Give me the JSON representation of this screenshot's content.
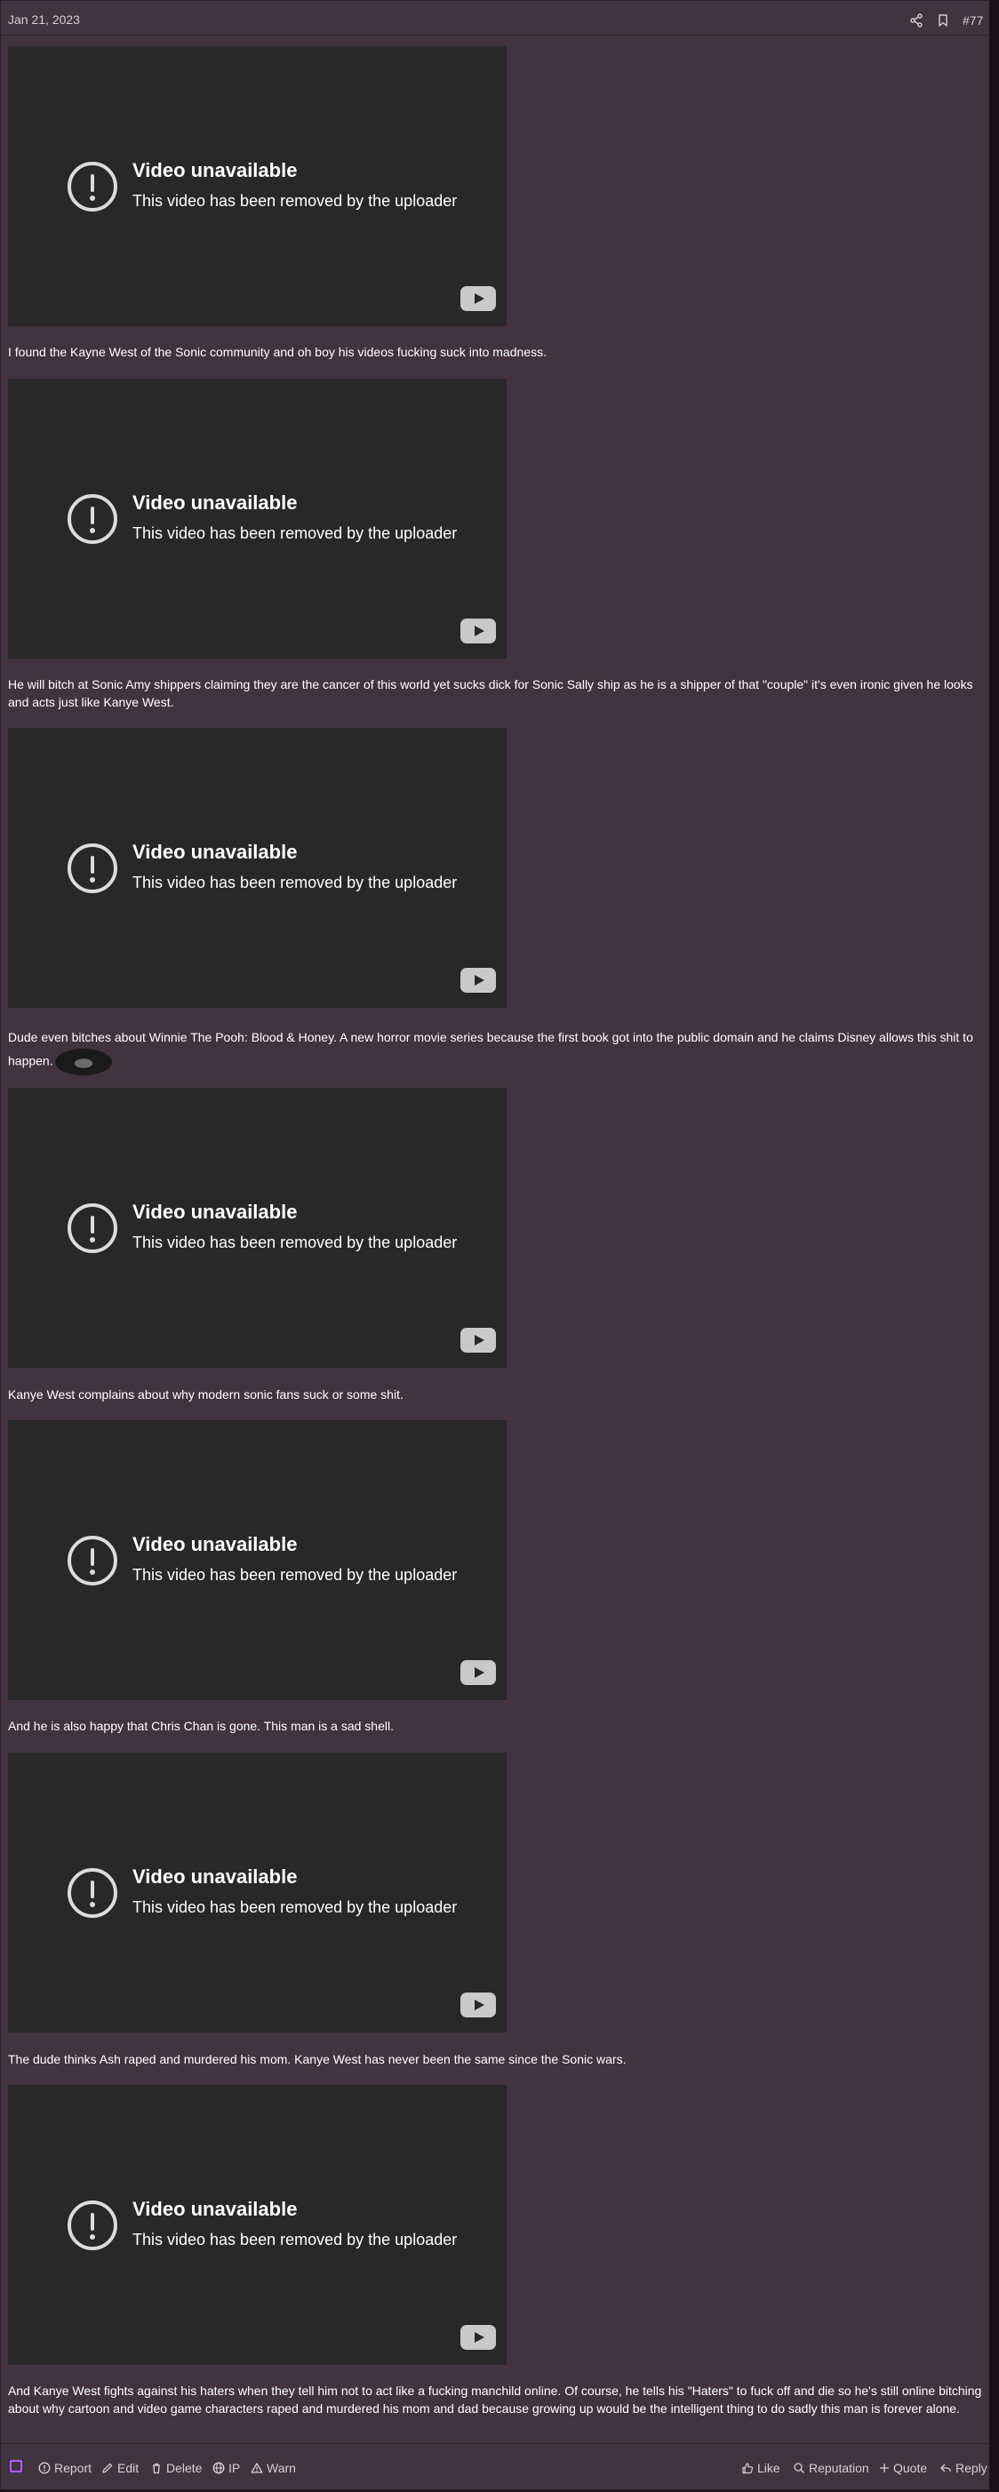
{
  "header": {
    "date": "Jan 21, 2023",
    "post_number": "#77",
    "share_icon": "share-icon",
    "bookmark_icon": "bookmark-icon"
  },
  "video": {
    "title": "Video unavailable",
    "subtitle": "This video has been removed by the uploader",
    "warning_icon": "exclamation-circle-icon",
    "play_icon": "youtube-play-icon"
  },
  "paragraphs": [
    "I found the Kayne West of the Sonic community and oh boy his videos fucking suck into madness.",
    "He will bitch at Sonic Amy shippers claiming they are the cancer of this world yet sucks dick for Sonic Sally ship as he is a shipper of that \"couple\" it's even ironic given he looks and acts just like Kanye West.",
    "Dude even bitches about Winnie The Pooh: Blood & Honey. A new horror movie series because the first book got into the public domain and he claims Disney allows this shit to happen.",
    "Kanye West complains about why modern sonic fans suck or some shit.",
    "And he is also happy that Chris Chan is gone. This man is a sad shell.",
    "The dude thinks Ash raped and murdered his mom. Kanye West has never been the same since the Sonic wars.",
    "And Kanye West fights against his haters when they tell him not to act like a fucking manchild online. Of course, he tells his \"Haters\" to fuck off and die so he's still online bitching about why cartoon and video game characters raped and murdered his mom and dad because growing up would be the intelligent thing to do sadly this man is forever alone."
  ],
  "footer": {
    "report": "Report",
    "edit": "Edit",
    "delete": "Delete",
    "ip": "IP",
    "warn": "Warn",
    "like": "Like",
    "reputation": "Reputation",
    "quote": "Quote",
    "reply": "Reply"
  },
  "colors": {
    "post_bg": "#42343f",
    "video_bg": "#282828",
    "select_accent": "#b15cff"
  }
}
